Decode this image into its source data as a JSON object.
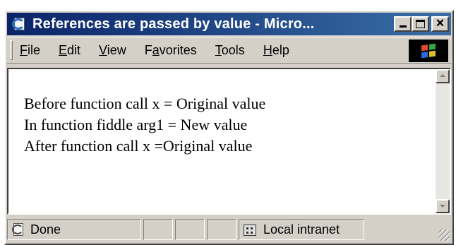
{
  "window": {
    "title": "References are passed by value - Micro..."
  },
  "menu": {
    "items": [
      {
        "label": "File",
        "accel": "F",
        "rest": "ile"
      },
      {
        "label": "Edit",
        "accel": "E",
        "rest": "dit"
      },
      {
        "label": "View",
        "accel": "V",
        "rest": "iew"
      },
      {
        "label": "Favorites",
        "pre": "F",
        "accel": "a",
        "rest": "vorites"
      },
      {
        "label": "Tools",
        "accel": "T",
        "rest": "ools"
      },
      {
        "label": "Help",
        "accel": "H",
        "rest": "elp"
      }
    ]
  },
  "content": {
    "lines": [
      "Before function call x = Original value",
      "In function fiddle arg1 = New value",
      "After function call x =Original value"
    ]
  },
  "status": {
    "text": "Done",
    "zone": "Local intranet"
  },
  "colors": {
    "titlebar_start": "#0a246a",
    "titlebar_end": "#3a6ea5",
    "chrome": "#d4d0c8"
  },
  "icons": {
    "app": "ie-page-icon",
    "status": "ie-page-icon",
    "zone": "local-intranet-icon",
    "brand": "windows-logo-icon"
  }
}
